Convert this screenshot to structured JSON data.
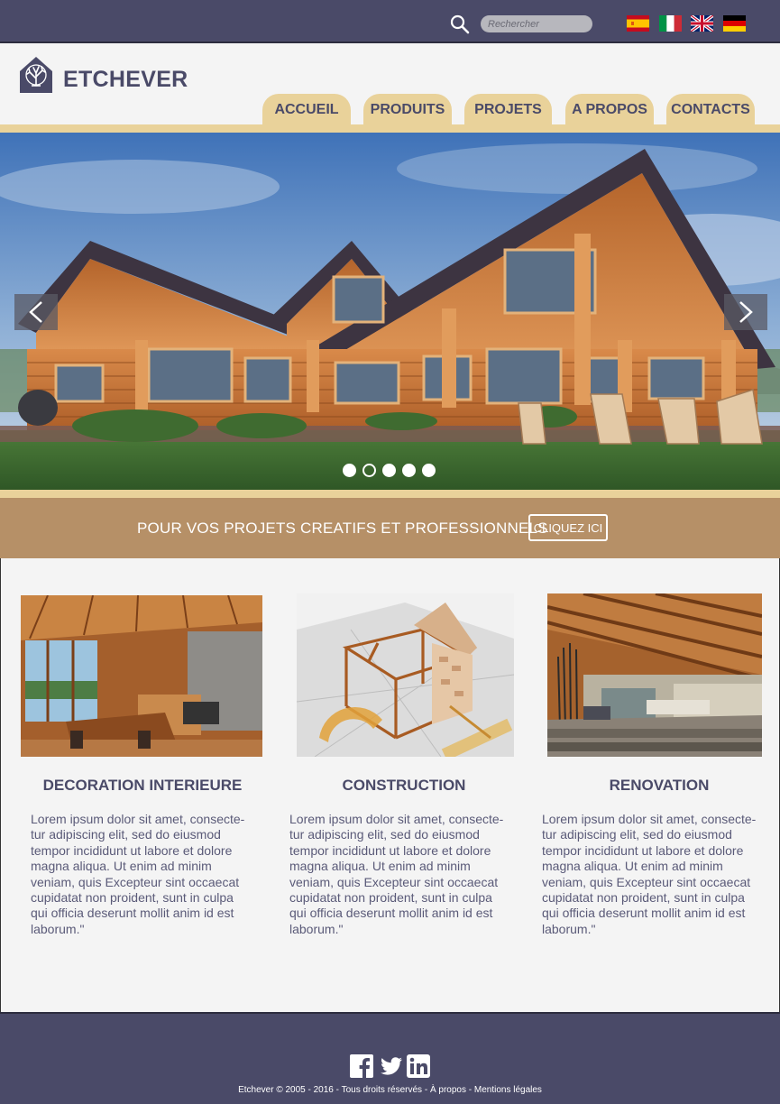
{
  "top_bar": {
    "search_placeholder": "Rechercher",
    "languages": [
      "Español",
      "Italiano",
      "English",
      "Deutsch"
    ]
  },
  "header": {
    "brand": "ETCHEVER",
    "nav": [
      "ACCUEIL",
      "PRODUITS",
      "PROJETS",
      "A PROPOS",
      "CONTACTS"
    ]
  },
  "slider": {
    "slide_count": 5,
    "active_slide": 2
  },
  "banner": {
    "text": "POUR VOS PROJETS CREATIFS ET PROFESSIONNELS",
    "button": "CLIQUEZ ICI"
  },
  "cards": [
    {
      "title": "DECORATION INTERIEURE",
      "lines": [
        "Lorem ipsum dolor sit amet, consecte-",
        "tur adipiscing elit, sed do eiusmod",
        "tempor incididunt ut labore et dolore",
        "magna aliqua. Ut enim ad minim",
        "veniam, quis  Excepteur sint occaecat",
        "cupidatat non proident, sunt in culpa",
        "qui officia deserunt mollit anim id est",
        "laborum.\""
      ]
    },
    {
      "title": "CONSTRUCTION",
      "lines": [
        "Lorem ipsum dolor sit amet, consecte-",
        "tur adipiscing elit, sed do eiusmod",
        "tempor incididunt ut labore et dolore",
        "magna aliqua. Ut enim ad minim",
        "veniam, quis  Excepteur sint occaecat",
        "cupidatat non proident, sunt in culpa",
        "qui officia deserunt mollit anim id est",
        "laborum.\""
      ]
    },
    {
      "title": "RENOVATION",
      "lines": [
        "Lorem ipsum dolor sit amet, consecte-",
        "tur adipiscing elit, sed do eiusmod",
        "tempor incididunt ut labore et dolore",
        "magna aliqua. Ut enim ad minim",
        "veniam, quis  Excepteur sint occaecat",
        "cupidatat non proident, sunt in culpa",
        "qui officia deserunt mollit anim id est",
        "laborum.\""
      ]
    }
  ],
  "footer": {
    "social": [
      "facebook-icon",
      "twitter-icon",
      "linkedin-icon"
    ],
    "company": "Etchever",
    "copyright": "©  2005 - 2016",
    "rights": "Tous droits réservés",
    "about": "À propos",
    "legal": "Mentions légales"
  },
  "colors": {
    "primary": "#4a4a68",
    "gold": "#e9d29a",
    "banner": "#b69067",
    "background": "#f4f4f4"
  }
}
